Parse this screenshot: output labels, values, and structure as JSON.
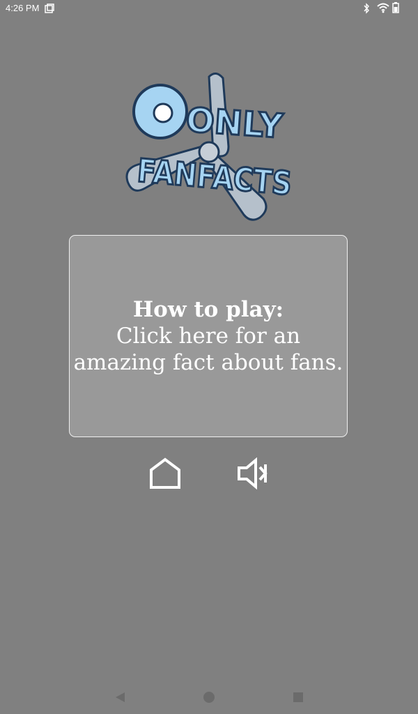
{
  "status_bar": {
    "time": "4:26 PM",
    "left_icon": "screenshot-icon",
    "right_icons": [
      "bluetooth-icon",
      "wifi-icon",
      "battery-icon"
    ]
  },
  "logo": {
    "line1": "ONLY",
    "line2": "FANFACTS",
    "colors": {
      "letters": "#a6d4f2",
      "outline": "#1f3a5a",
      "blades": "#b5c0cb"
    }
  },
  "card": {
    "title": "How to play:",
    "body": "Click here for an amazing fact about fans."
  },
  "controls": {
    "home_icon": "home-outline-icon",
    "sound_icon": "volume-muted-icon"
  },
  "nav_bar": {
    "buttons": [
      "back-triangle-icon",
      "home-circle-icon",
      "recents-square-icon"
    ]
  },
  "colors": {
    "background": "#808080",
    "card_background": "#999999",
    "card_border": "#efefef",
    "text": "#ffffff",
    "nav_icons": "#6b6b6b"
  }
}
